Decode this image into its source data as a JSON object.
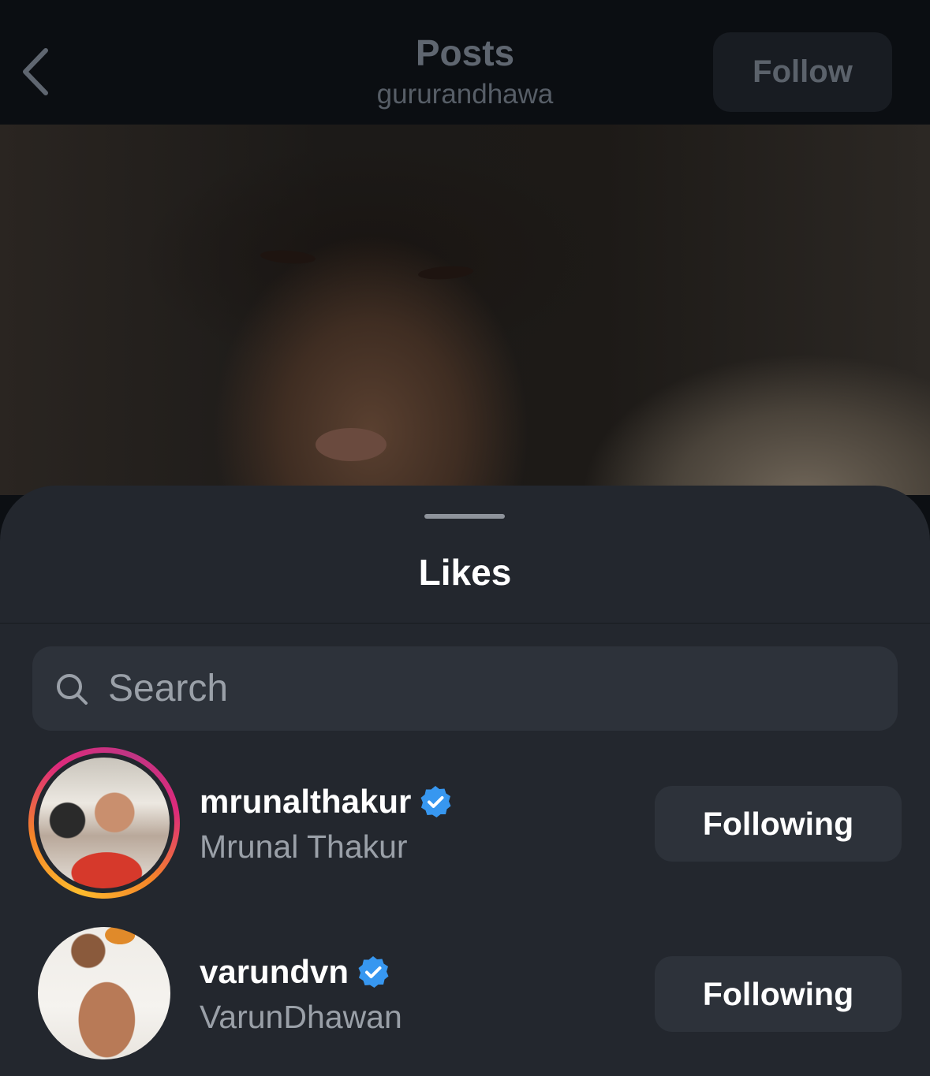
{
  "header": {
    "title": "Posts",
    "subtitle": "gururandhawa",
    "follow_label": "Follow",
    "back_icon": "chevron-left-icon"
  },
  "likes_sheet": {
    "title": "Likes",
    "search": {
      "placeholder": "Search",
      "value": "",
      "icon": "search-icon"
    },
    "users": [
      {
        "username": "mrunalthakur",
        "full_name": "Mrunal Thakur",
        "verified": true,
        "has_story_ring": true,
        "button_label": "Following"
      },
      {
        "username": "varundvn",
        "full_name": "VarunDhawan",
        "verified": true,
        "has_story_ring": false,
        "button_label": "Following"
      }
    ]
  },
  "colors": {
    "sheet_background": "#23272e",
    "button_background": "#2d323a",
    "verified_badge": "#3797f0",
    "secondary_text": "#9aa0a8"
  }
}
